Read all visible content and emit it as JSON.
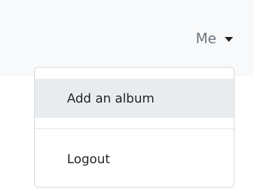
{
  "navbar": {
    "user_menu_label": "Me"
  },
  "dropdown": {
    "items": [
      {
        "label": "Add an album"
      },
      {
        "label": "Logout"
      }
    ]
  },
  "colors": {
    "navbar_background": "#f8f9fa",
    "hover_background": "#e9ecef",
    "menu_border": "#d3d6da"
  },
  "icons": {
    "user_menu_toggle": "caret-down-icon"
  }
}
